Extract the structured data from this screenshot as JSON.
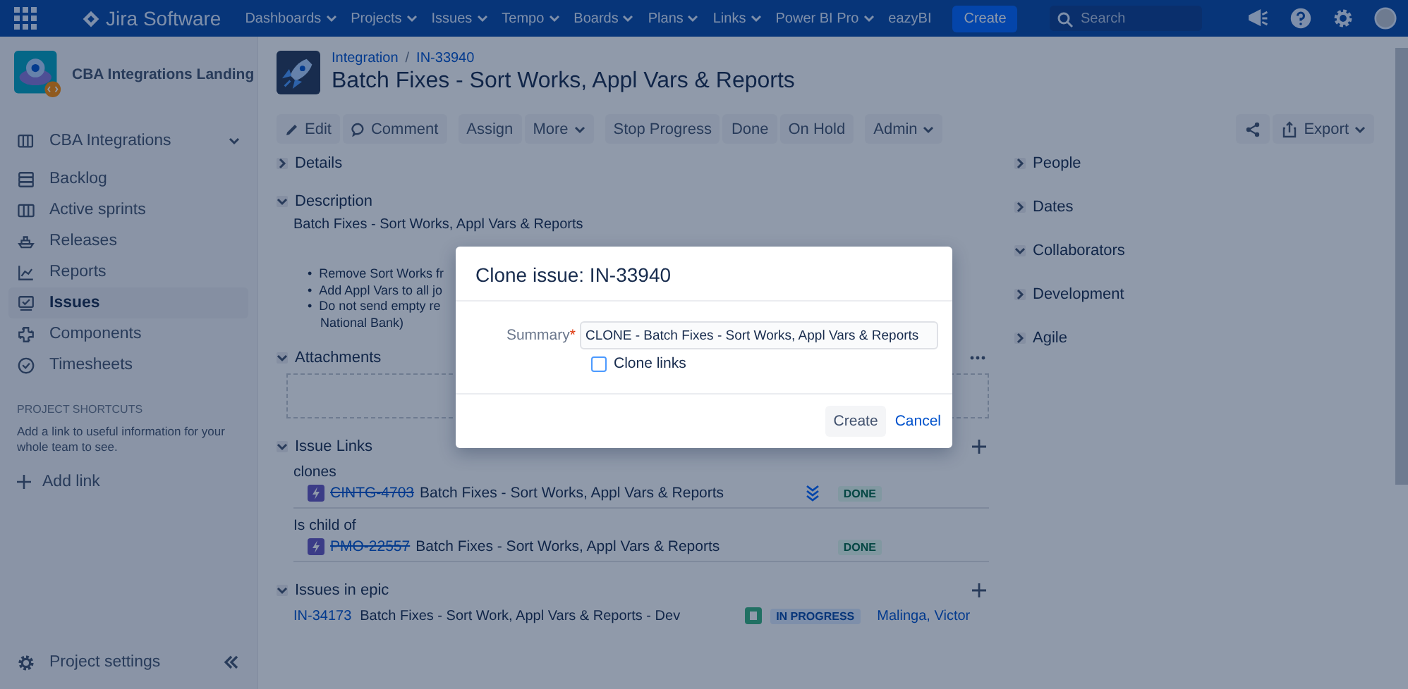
{
  "topbar": {
    "product": "Jira Software",
    "menus": [
      {
        "label": "Dashboards",
        "dropdown": true
      },
      {
        "label": "Projects",
        "dropdown": true
      },
      {
        "label": "Issues",
        "dropdown": true
      },
      {
        "label": "Tempo",
        "dropdown": true
      },
      {
        "label": "Boards",
        "dropdown": true
      },
      {
        "label": "Plans",
        "dropdown": true
      },
      {
        "label": "Links",
        "dropdown": true
      },
      {
        "label": "Power BI Pro",
        "dropdown": true
      },
      {
        "label": "eazyBI",
        "dropdown": false
      }
    ],
    "create": "Create",
    "search": {
      "placeholder": "Search"
    }
  },
  "sidebar": {
    "project": "CBA Integrations Landing",
    "board": "CBA Integrations",
    "items": [
      {
        "label": "Backlog",
        "kind": "backlog",
        "selected": false
      },
      {
        "label": "Active sprints",
        "kind": "sprints",
        "selected": false
      },
      {
        "label": "Releases",
        "kind": "releases",
        "selected": false
      },
      {
        "label": "Reports",
        "kind": "reports",
        "selected": false
      },
      {
        "label": "Issues",
        "kind": "issues",
        "selected": true
      },
      {
        "label": "Components",
        "kind": "components",
        "selected": false
      },
      {
        "label": "Timesheets",
        "kind": "timesheets",
        "selected": false
      }
    ],
    "shortcuts_heading": "PROJECT SHORTCUTS",
    "shortcuts_text": "Add a link to useful information for your whole team to see.",
    "add_link": "Add link",
    "settings": "Project settings"
  },
  "issue": {
    "breadcrumbs": [
      "Integration",
      "IN-33940"
    ],
    "separator": "/",
    "title": "Batch Fixes - Sort Works, Appl Vars & Reports",
    "action_groups": [
      [
        {
          "label": "Edit",
          "kind": "edit",
          "dropdown": false
        },
        {
          "label": "Comment",
          "kind": "comment",
          "dropdown": false
        }
      ],
      [
        {
          "label": "Assign",
          "kind": "plain",
          "dropdown": false
        },
        {
          "label": "More",
          "kind": "plain",
          "dropdown": true
        }
      ],
      [
        {
          "label": "Stop Progress",
          "kind": "plain",
          "dropdown": false
        },
        {
          "label": "Done",
          "kind": "plain",
          "dropdown": false
        },
        {
          "label": "On Hold",
          "kind": "plain",
          "dropdown": false
        }
      ],
      [
        {
          "label": "Admin",
          "kind": "plain",
          "dropdown": true
        }
      ]
    ],
    "export": "Export"
  },
  "details": {
    "label": "Details",
    "expanded": false
  },
  "description": {
    "label": "Description",
    "expanded": true,
    "text": "Batch Fixes - Sort Works, Appl Vars & Reports",
    "bullets": [
      {
        "marker": "•",
        "text": "Remove Sort Works fr"
      },
      {
        "marker": "•",
        "text": "Add Appl Vars to all jo"
      },
      {
        "marker": "•",
        "text": "Do not send empty re"
      }
    ],
    "continuation": "National Bank)"
  },
  "attachments": {
    "label": "Attachments",
    "expanded": true
  },
  "issue_links": {
    "label": "Issue Links",
    "expanded": true,
    "groups": [
      {
        "relation": "clones",
        "items": [
          {
            "key": "CINTG-4703",
            "summary": "Batch Fixes - Sort Works, Appl Vars & Reports",
            "resolved": true,
            "priority_shown": true,
            "status": "DONE"
          }
        ]
      },
      {
        "relation": "Is child of",
        "items": [
          {
            "key": "PMO-22557",
            "summary": "Batch Fixes - Sort Works, Appl Vars & Reports",
            "resolved": true,
            "priority_shown": false,
            "status": "DONE"
          }
        ]
      }
    ]
  },
  "issues_in_epic": {
    "label": "Issues in epic",
    "expanded": true,
    "rows": [
      {
        "key": "IN-34173",
        "summary": "Batch Fixes - Sort Work, Appl Vars & Reports - Dev",
        "status": "IN PROGRESS",
        "assignee": "Malinga, Victor"
      }
    ]
  },
  "right_sections": [
    {
      "label": "People",
      "expanded": false
    },
    {
      "label": "Dates",
      "expanded": false
    },
    {
      "label": "Collaborators",
      "expanded": true
    },
    {
      "label": "Development",
      "expanded": false
    },
    {
      "label": "Agile",
      "expanded": false
    }
  ],
  "modal": {
    "title": "Clone issue: IN-33940",
    "field_label": "Summary",
    "required_mark": "*",
    "value": "CLONE - Batch Fixes - Sort Works, Appl Vars & Reports",
    "checkbox": {
      "label": "Clone links",
      "checked": false
    },
    "primary": "Create",
    "cancel": "Cancel"
  }
}
